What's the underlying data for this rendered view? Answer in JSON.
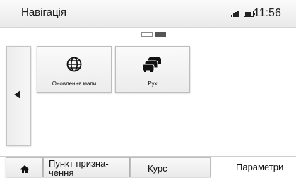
{
  "header": {
    "title": "Навігація",
    "time": "11:56",
    "signal_icon": "signal-icon",
    "battery_icon": "battery-icon"
  },
  "pager": {
    "pages": 2,
    "current": 2
  },
  "left_panel": {
    "icon": "left-arrow-icon"
  },
  "tiles": [
    {
      "label": "Оновлення мапи",
      "icon": "globe-icon"
    },
    {
      "label": "Рух",
      "icon": "traffic-cars-icon"
    }
  ],
  "bottom_bar": {
    "home_icon": "home-icon",
    "destination_label": "Пункт призна-\nчення",
    "route_label": "Курс",
    "settings_label": "Параметри"
  },
  "colors": {
    "background": "#ffffff",
    "text": "#111111",
    "tile_border": "#bdbdbd"
  }
}
